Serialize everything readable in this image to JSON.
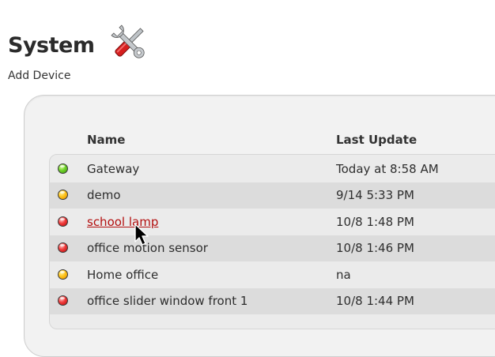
{
  "header": {
    "title": "System",
    "subtitle": "Add Device",
    "icon": "tools-icon"
  },
  "table": {
    "columns": {
      "name": "Name",
      "last_update": "Last Update"
    },
    "rows": [
      {
        "name": "Gateway",
        "last_update": "Today at 8:58 AM",
        "status": "green",
        "hovered": false
      },
      {
        "name": "demo",
        "last_update": "9/14 5:33 PM",
        "status": "yellow",
        "hovered": false
      },
      {
        "name": "school lamp",
        "last_update": "10/8 1:48 PM",
        "status": "red",
        "hovered": true
      },
      {
        "name": "office motion sensor",
        "last_update": "10/8 1:46 PM",
        "status": "red",
        "hovered": false
      },
      {
        "name": "Home office",
        "last_update": "na",
        "status": "yellow",
        "hovered": false
      },
      {
        "name": "office slider window front 1",
        "last_update": "10/8 1:44 PM",
        "status": "red",
        "hovered": false
      }
    ]
  },
  "colors": {
    "status_green": "#6fd22a",
    "status_yellow": "#ffc41a",
    "status_red": "#f03a3a",
    "link_red": "#b30f0f",
    "row_alt": "#dcdcdc"
  },
  "cursor": "arrow-pointer-icon"
}
